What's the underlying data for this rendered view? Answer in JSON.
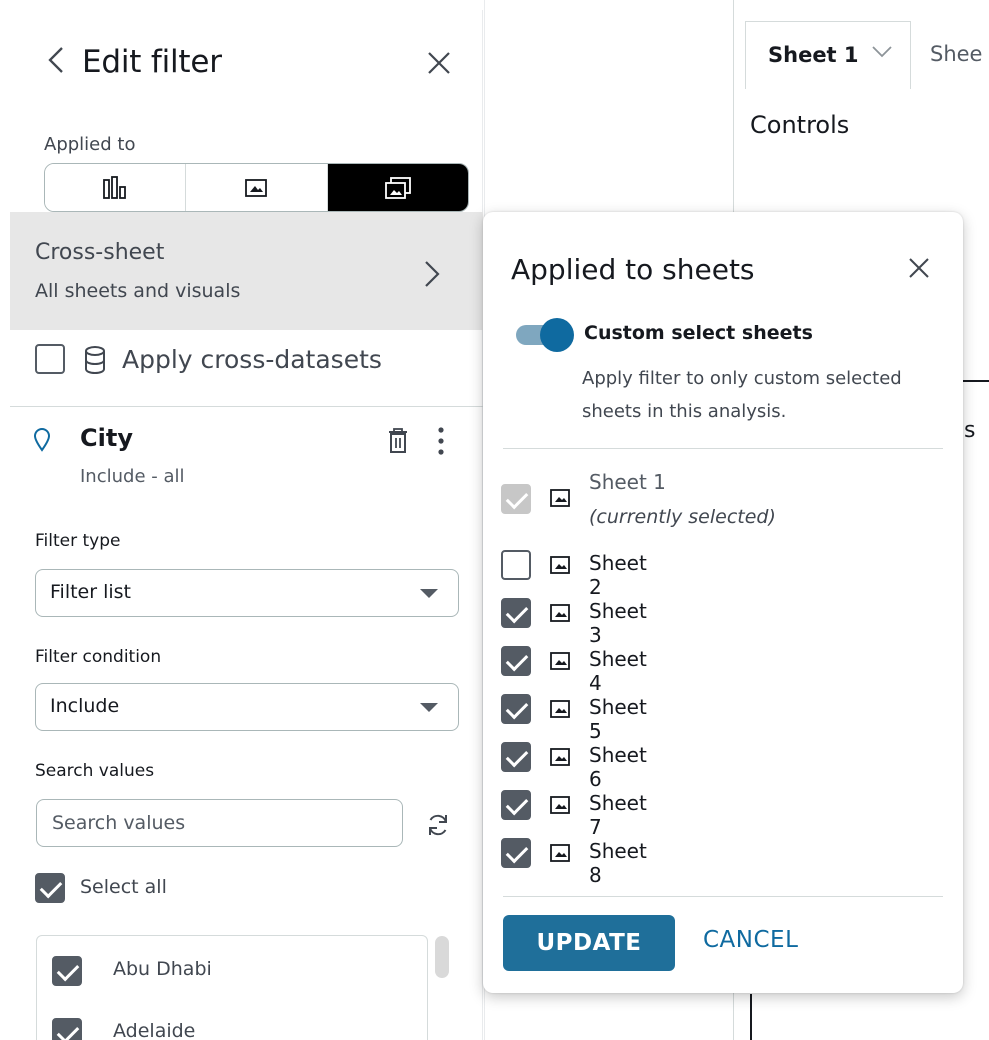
{
  "panel": {
    "title": "Edit filter",
    "applied_to_label": "Applied to",
    "applied_to_options": [
      "visual",
      "sheet",
      "cross-sheet"
    ],
    "cross_sheet": {
      "title": "Cross-sheet",
      "subtitle": "All sheets and visuals"
    },
    "apply_cross_datasets_label": "Apply cross-datasets",
    "field": {
      "name": "City",
      "summary": "Include - all"
    },
    "filter_type": {
      "label": "Filter type",
      "value": "Filter list"
    },
    "filter_condition": {
      "label": "Filter condition",
      "value": "Include"
    },
    "search": {
      "label": "Search values",
      "placeholder": "Search values"
    },
    "select_all_label": "Select all",
    "values": [
      {
        "label": "Abu Dhabi",
        "checked": true
      },
      {
        "label": "Adelaide",
        "checked": true
      }
    ]
  },
  "sheets_bar": {
    "active_tab": "Sheet 1",
    "next_tab": "Shee",
    "controls_label": "Controls",
    "partial_text": "ds"
  },
  "popup": {
    "title": "Applied to sheets",
    "toggle_label": "Custom select sheets",
    "toggle_on": true,
    "description": "Apply filter to only custom selected sheets in this analysis.",
    "sheets": [
      {
        "name": "Sheet 1",
        "note": "(currently selected)",
        "checked": true,
        "disabled": true
      },
      {
        "name": "Sheet 2",
        "note": "",
        "checked": false,
        "disabled": false
      },
      {
        "name": "Sheet 3",
        "note": "",
        "checked": true,
        "disabled": false
      },
      {
        "name": "Sheet 4",
        "note": "",
        "checked": true,
        "disabled": false
      },
      {
        "name": "Sheet 5",
        "note": "",
        "checked": true,
        "disabled": false
      },
      {
        "name": "Sheet 6",
        "note": "",
        "checked": true,
        "disabled": false
      },
      {
        "name": "Sheet 7",
        "note": "",
        "checked": true,
        "disabled": false
      },
      {
        "name": "Sheet 8",
        "note": "",
        "checked": true,
        "disabled": false
      }
    ],
    "update_label": "UPDATE",
    "cancel_label": "CANCEL"
  },
  "colors": {
    "accent": "#0f6aa0",
    "update_button": "#1f6f9a",
    "selected_segment": "#000000",
    "cross_sheet_row": "#e7e7e7"
  },
  "icons": {
    "back": "chevron-left-icon",
    "close": "close-icon",
    "visual_scope": "bar-chart-icon",
    "sheet_scope": "sheet-icon",
    "cross_sheet_scope": "multiple-sheets-icon",
    "forward": "chevron-right-icon",
    "database": "database-icon",
    "field": "location-pin-icon",
    "delete": "trash-icon",
    "more": "more-vertical-icon",
    "refresh": "refresh-icon"
  }
}
